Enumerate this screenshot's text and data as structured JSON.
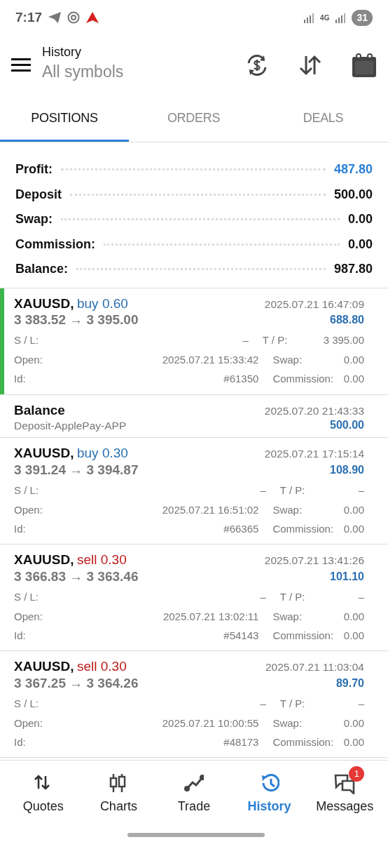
{
  "status_bar": {
    "time": "7:17",
    "battery": "31",
    "network": "4G"
  },
  "header": {
    "title": "History",
    "subtitle": "All symbols"
  },
  "tabs": [
    {
      "label": "POSITIONS",
      "selected": true
    },
    {
      "label": "ORDERS",
      "selected": false
    },
    {
      "label": "DEALS",
      "selected": false
    }
  ],
  "summary": [
    {
      "label": "Profit:",
      "value": "487.80",
      "kind": "profit"
    },
    {
      "label": "Deposit",
      "value": "500.00",
      "kind": "plain"
    },
    {
      "label": "Swap:",
      "value": "0.00",
      "kind": "plain"
    },
    {
      "label": "Commission:",
      "value": "0.00",
      "kind": "plain"
    },
    {
      "label": "Balance:",
      "value": "987.80",
      "kind": "plain"
    }
  ],
  "deals": [
    {
      "kind": "position",
      "selected": true,
      "symbol": "XAUUSD,",
      "side": "buy",
      "volume": "0.60",
      "prices": "3 383.52 → 3 395.00",
      "time": "2025.07.21 16:47:09",
      "profit": "688.80",
      "fields": [
        [
          "S / L:",
          "–",
          "T / P:",
          "3 395.00"
        ],
        [
          "Open:",
          "2025.07.21 15:33:42",
          "Swap:",
          "0.00"
        ],
        [
          "Id:",
          "#61350",
          "Commission:",
          "0.00"
        ]
      ]
    },
    {
      "kind": "balance",
      "selected": false,
      "title": "Balance",
      "comment": "Deposit-ApplePay-APP",
      "time": "2025.07.20 21:43:33",
      "profit": "500.00"
    },
    {
      "kind": "position",
      "selected": false,
      "symbol": "XAUUSD,",
      "side": "buy",
      "volume": "0.30",
      "prices": "3 391.24 → 3 394.87",
      "time": "2025.07.21 17:15:14",
      "profit": "108.90",
      "fields": [
        [
          "S / L:",
          "–",
          "T / P:",
          "–"
        ],
        [
          "Open:",
          "2025.07.21 16:51:02",
          "Swap:",
          "0.00"
        ],
        [
          "Id:",
          "#66365",
          "Commission:",
          "0.00"
        ]
      ]
    },
    {
      "kind": "position",
      "selected": false,
      "symbol": "XAUUSD,",
      "side": "sell",
      "volume": "0.30",
      "prices": "3 366.83 → 3 363.46",
      "time": "2025.07.21 13:41:26",
      "profit": "101.10",
      "fields": [
        [
          "S / L:",
          "–",
          "T / P:",
          "–"
        ],
        [
          "Open:",
          "2025.07.21 13:02:11",
          "Swap:",
          "0.00"
        ],
        [
          "Id:",
          "#54143",
          "Commission:",
          "0.00"
        ]
      ]
    },
    {
      "kind": "position",
      "selected": false,
      "symbol": "XAUUSD,",
      "side": "sell",
      "volume": "0.30",
      "prices": "3 367.25 → 3 364.26",
      "time": "2025.07.21 11:03:04",
      "profit": "89.70",
      "fields": [
        [
          "S / L:",
          "–",
          "T / P:",
          "–"
        ],
        [
          "Open:",
          "2025.07.21 10:00:55",
          "Swap:",
          "0.00"
        ],
        [
          "Id:",
          "#48173",
          "Commission:",
          "0.00"
        ]
      ]
    }
  ],
  "bottom_nav": [
    {
      "label": "Quotes",
      "selected": false
    },
    {
      "label": "Charts",
      "selected": false
    },
    {
      "label": "Trade",
      "selected": false
    },
    {
      "label": "History",
      "selected": true
    },
    {
      "label": "Messages",
      "selected": false,
      "badge": "1"
    }
  ]
}
